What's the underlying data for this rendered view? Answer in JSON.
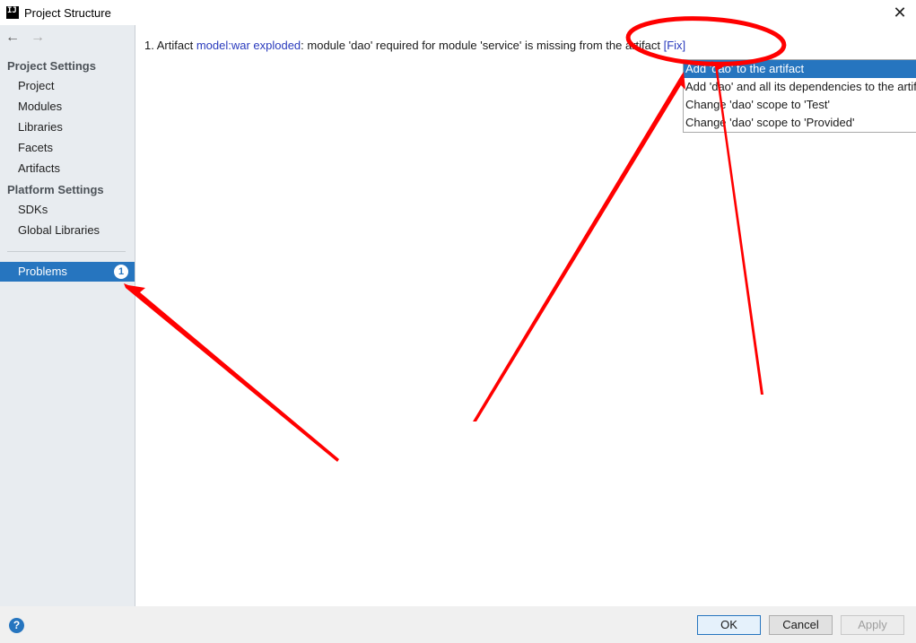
{
  "window": {
    "app_logo": "IJ",
    "title": "Project Structure",
    "close_glyph": "✕"
  },
  "sidebar": {
    "back_glyph": "←",
    "forward_glyph": "→",
    "project_settings_header": "Project Settings",
    "project_items": [
      "Project",
      "Modules",
      "Libraries",
      "Facets",
      "Artifacts"
    ],
    "platform_settings_header": "Platform Settings",
    "platform_items": [
      "SDKs",
      "Global Libraries"
    ],
    "problems": {
      "label": "Problems",
      "count": "1"
    }
  },
  "main": {
    "problem": {
      "prefix": "1. Artifact ",
      "artifact_link": "model:war exploded",
      "message": ": module 'dao' required for module 'service' is missing from the artifact ",
      "fix_link": "[Fix]"
    },
    "fix_popup": {
      "items": [
        "Add 'dao' to the artifact",
        "Add 'dao' and all its dependencies to the artifact",
        "Change 'dao' scope to 'Test'",
        "Change 'dao' scope to 'Provided'"
      ],
      "highlighted_index": 0
    }
  },
  "footer": {
    "help_glyph": "?",
    "ok_label": "OK",
    "cancel_label": "Cancel",
    "apply_label": "Apply"
  },
  "colors": {
    "accent": "#2675bf",
    "sidebar_bg": "#e8ecf0",
    "link": "#2a3bbd",
    "annotation": "#ff0000"
  }
}
